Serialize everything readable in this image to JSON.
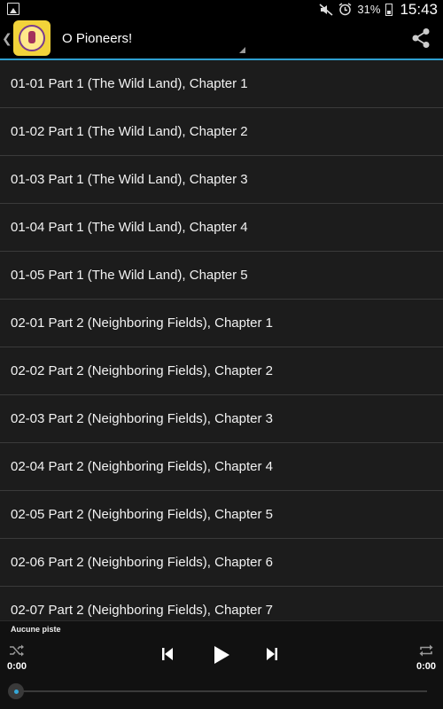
{
  "status_bar": {
    "battery_percent": "31%",
    "time": "15:43"
  },
  "action_bar": {
    "title": "O Pioneers!",
    "accent_color": "#2e9fd0"
  },
  "chapters": [
    "01-01 Part 1 (The Wild Land), Chapter 1",
    "01-02 Part 1 (The Wild Land), Chapter 2",
    "01-03 Part 1 (The Wild Land), Chapter 3",
    "01-04 Part 1 (The Wild Land), Chapter 4",
    "01-05 Part 1 (The Wild Land), Chapter 5",
    "02-01 Part 2 (Neighboring Fields), Chapter 1",
    "02-02 Part 2 (Neighboring Fields), Chapter 2",
    "02-03 Part 2 (Neighboring Fields), Chapter 3",
    "02-04 Part 2 (Neighboring Fields), Chapter 4",
    "02-05 Part 2 (Neighboring Fields), Chapter 5",
    "02-06 Part 2 (Neighboring Fields), Chapter 6",
    "02-07 Part 2 (Neighboring Fields), Chapter 7"
  ],
  "player": {
    "track_label": "Aucune piste",
    "elapsed": "0:00",
    "duration": "0:00",
    "progress": 0
  }
}
